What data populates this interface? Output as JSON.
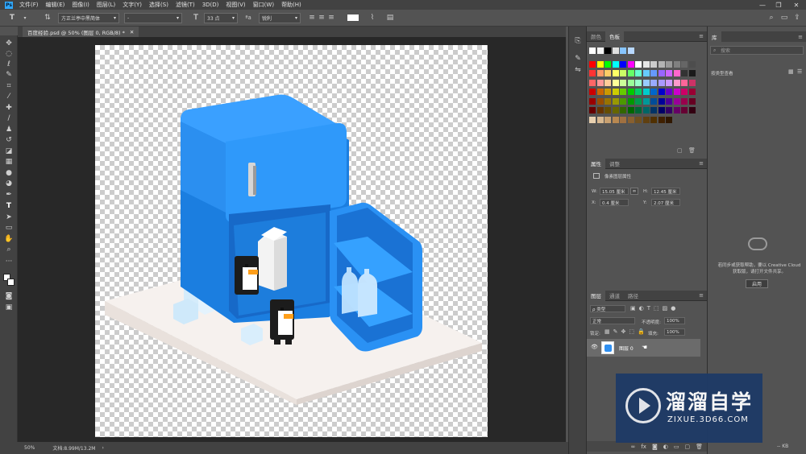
{
  "app": {
    "logo": "Ps"
  },
  "menu": [
    "文件(F)",
    "编辑(E)",
    "图像(I)",
    "图层(L)",
    "文字(Y)",
    "选择(S)",
    "滤镜(T)",
    "3D(D)",
    "视图(V)",
    "窗口(W)",
    "帮助(H)"
  ],
  "options": {
    "font_family": "方正兰亭中黑简体",
    "font_style": "-",
    "font_size": "33 点",
    "antialias": "锐利"
  },
  "document": {
    "tab_label": "百度经验.psd @ 50% (图层 0, RGB/8) *"
  },
  "status": {
    "zoom": "50%",
    "doc_size": "文档:8.99M/13.2M"
  },
  "swatches_panel": {
    "tabs": [
      "颜色",
      "色板"
    ],
    "colors": {
      "blue": "#2f8ff0",
      "dark_blue": "#1c6fd0",
      "floor": "#f4efec"
    }
  },
  "properties_panel": {
    "tabs": [
      "属性",
      "调整"
    ],
    "title": "像素图层属性",
    "w_label": "W:",
    "w_value": "15.05 厘米",
    "h_label": "H:",
    "h_value": "12.45 厘米",
    "x_label": "X:",
    "x_value": "0.4 厘米",
    "y_label": "Y:",
    "y_value": "2.07 厘米"
  },
  "layers_panel": {
    "tabs": [
      "图层",
      "通道",
      "路径"
    ],
    "filter": "ρ 类型",
    "blend_mode": "正常",
    "opacity_label": "不透明度:",
    "opacity_value": "100%",
    "lock_label": "锁定:",
    "fill_label": "填充:",
    "fill_value": "100%",
    "layer_name": "图层 0"
  },
  "library_panel": {
    "tab": "库",
    "search_placeholder": "搜索",
    "view_label": "按类型查看",
    "message_line1": "若同步或获取帮助，要以 Creative Cloud",
    "message_line2": "获取版，请打开文件共享。",
    "enable_button": "启用",
    "size_label": "-- KB"
  },
  "watermark": {
    "title": "溜溜自学",
    "url": "ZIXUE.3D66.COM"
  }
}
